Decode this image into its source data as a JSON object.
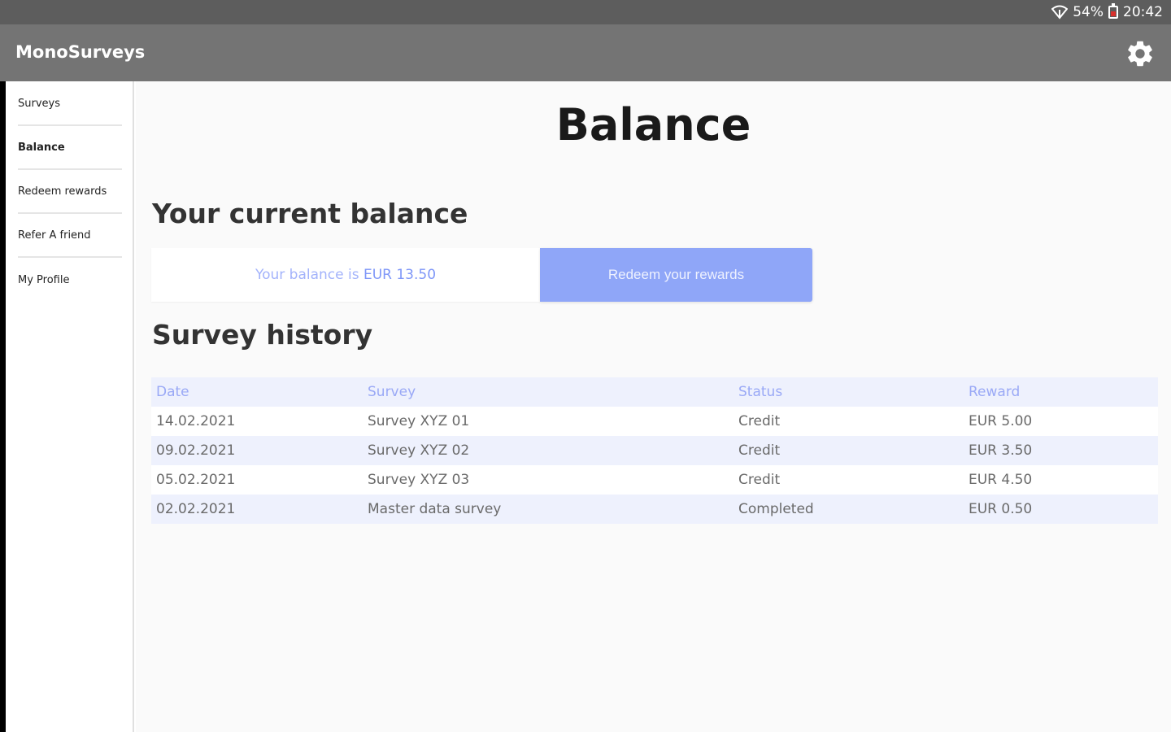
{
  "status_bar": {
    "battery": "54%",
    "time": "20:42"
  },
  "app_bar": {
    "title": "MonoSurveys",
    "settings_icon": "gear-icon"
  },
  "sidebar": {
    "items": [
      {
        "label": "Surveys"
      },
      {
        "label": "Balance",
        "active": true
      },
      {
        "label": "Redeem rewards"
      },
      {
        "label": "Refer A friend"
      },
      {
        "label": "My Profile"
      }
    ]
  },
  "main": {
    "title": "Balance",
    "current_balance_heading": "Your current balance",
    "balance_text": "Your balance is ",
    "balance_amount": "EUR 13.50",
    "redeem_label": "Redeem your rewards",
    "history_heading": "Survey history",
    "table": {
      "headers": [
        "Date",
        "Survey",
        "Status",
        "Reward"
      ],
      "rows": [
        [
          "14.02.2021",
          "Survey XYZ 01",
          "Credit",
          "EUR 5.00"
        ],
        [
          "09.02.2021",
          "Survey XYZ 02",
          "Credit",
          "EUR 3.50"
        ],
        [
          "05.02.2021",
          "Survey XYZ 03",
          "Credit",
          "EUR 4.50"
        ],
        [
          "02.02.2021",
          "Master data survey",
          "Completed",
          "EUR 0.50"
        ]
      ]
    }
  },
  "colors": {
    "status_bar": "#5d5d5d",
    "app_bar": "#747474",
    "accent": "#8fa6f8",
    "header_text": "#9aa9f6",
    "row_band": "#eef1fd"
  }
}
